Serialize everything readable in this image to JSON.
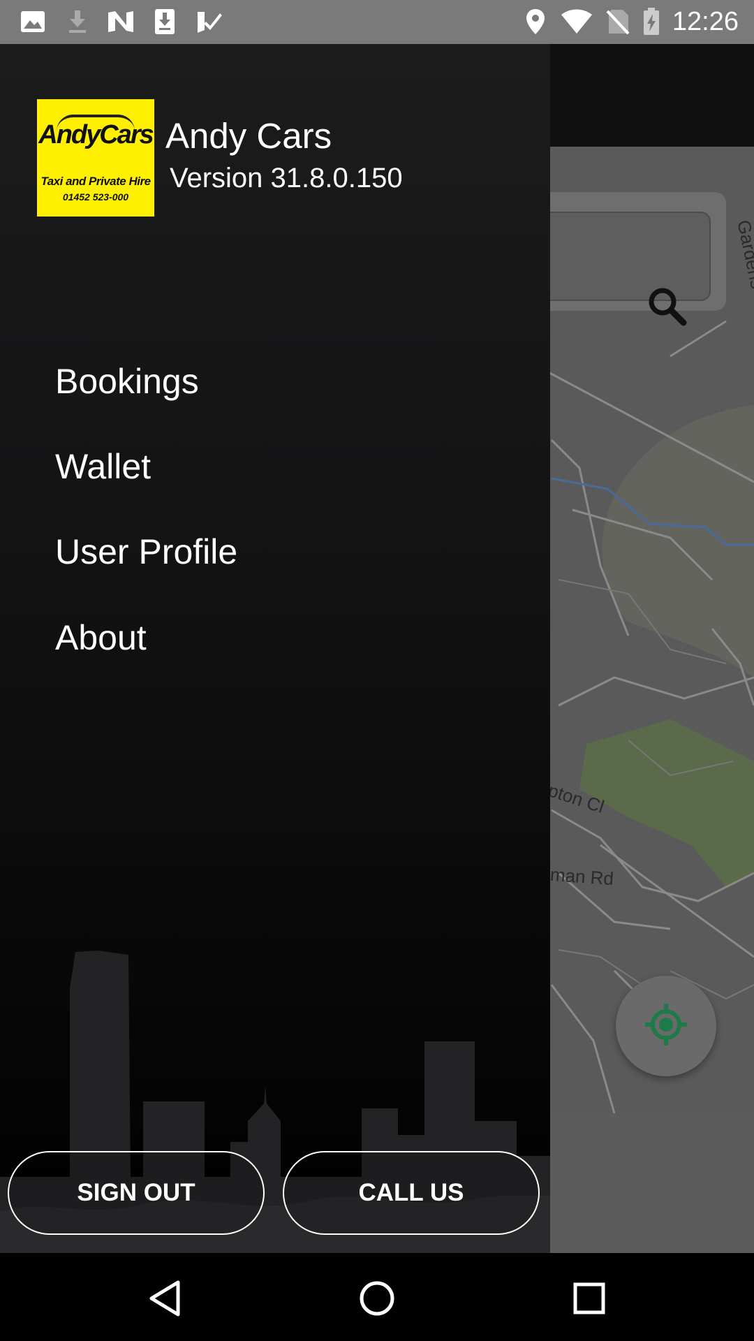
{
  "status_bar": {
    "time": "12:26",
    "left_icons": [
      "image-icon",
      "download-icon",
      "news-icon",
      "download-box-icon",
      "check-icon"
    ],
    "right_icons": [
      "location-pin-icon",
      "wifi-icon",
      "no-sim-icon",
      "battery-charging-icon"
    ]
  },
  "drawer": {
    "app_name": "Andy Cars",
    "version": "Version 31.8.0.150",
    "logo": {
      "brand": "AndyCars",
      "tagline": "Taxi and Private Hire",
      "phone": "01452 523-000",
      "background": "#ffef00"
    },
    "menu": [
      {
        "label": "Bookings"
      },
      {
        "label": "Wallet"
      },
      {
        "label": "User Profile"
      },
      {
        "label": "About"
      }
    ],
    "buttons": {
      "sign_out": "SIGN OUT",
      "call_us": "CALL US"
    }
  },
  "map": {
    "labels": {
      "gardens": "y Gardens",
      "close": "pton Cl",
      "road": "man Rd"
    },
    "locate_color": "#1f7a4a"
  },
  "nav_bar": {
    "buttons": [
      "back-icon",
      "home-icon",
      "recents-icon"
    ]
  },
  "colors": {
    "status_bar": "#7a7a7a",
    "drawer_top": "#1c1c1d",
    "map": "#5a5a5a"
  }
}
